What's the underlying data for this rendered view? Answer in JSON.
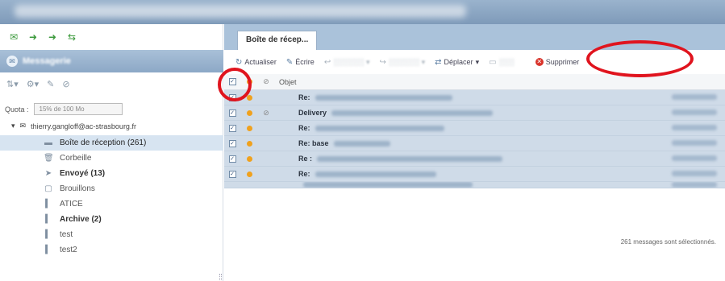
{
  "left_panel": {
    "section_title": "Messagerie",
    "quota_label": "Quota :",
    "quota_value": "15% de 100 Mo",
    "account": "thierry.gangloff@ac-strasbourg.fr",
    "folders": [
      {
        "label": "Boîte de réception (261)",
        "icon": "inbox-icon",
        "selected": true,
        "bold": false
      },
      {
        "label": "Corbeille",
        "icon": "trash-icon",
        "selected": false,
        "bold": false
      },
      {
        "label": "Envoyé (13)",
        "icon": "sent-icon",
        "selected": false,
        "bold": true
      },
      {
        "label": "Brouillons",
        "icon": "drafts-icon",
        "selected": false,
        "bold": false
      },
      {
        "label": "ATICE",
        "icon": "folder-icon",
        "selected": false,
        "bold": false
      },
      {
        "label": "Archive (2)",
        "icon": "folder-icon",
        "selected": false,
        "bold": true
      },
      {
        "label": "test",
        "icon": "folder-icon",
        "selected": false,
        "bold": false
      },
      {
        "label": "test2",
        "icon": "folder-icon",
        "selected": false,
        "bold": false
      }
    ]
  },
  "tabs": [
    {
      "label": "Boîte de récep..."
    }
  ],
  "toolbar": {
    "refresh": "Actualiser",
    "compose": "Écrire",
    "move": "Déplacer",
    "delete": "Supprimer"
  },
  "grid": {
    "subject_header": "Objet",
    "rows": [
      {
        "subject": "Re:",
        "attachment": false
      },
      {
        "subject": "Delivery",
        "attachment": true
      },
      {
        "subject": "Re:",
        "attachment": false
      },
      {
        "subject": "Re: base",
        "attachment": false
      },
      {
        "subject": "Re :",
        "attachment": false
      },
      {
        "subject": "Re:",
        "attachment": false
      },
      {
        "subject": "",
        "attachment": false
      }
    ]
  },
  "status_text": "261 messages sont sélectionnés.",
  "colors": {
    "highlight_ring": "#e0141e",
    "header_blue": "#8ca8c6",
    "unread_dot": "#f0a11d",
    "delete_red": "#d9342b"
  }
}
